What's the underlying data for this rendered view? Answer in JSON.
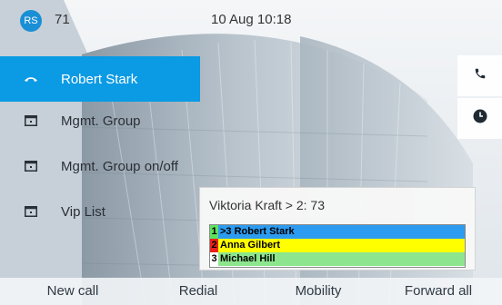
{
  "header": {
    "avatar_initials": "RS",
    "extension": "71",
    "datetime": "10 Aug 10:18"
  },
  "lines": [
    {
      "label": "Robert Stark",
      "icon": "phone-handset-icon",
      "active": true
    },
    {
      "label": "Mgmt. Group",
      "icon": "line-key-icon",
      "active": false
    },
    {
      "label": "Mgmt. Group on/off",
      "icon": "line-key-icon",
      "active": false
    },
    {
      "label": "Vip List",
      "icon": "line-key-icon",
      "active": false
    }
  ],
  "side_buttons": [
    {
      "icon": "phone-icon"
    },
    {
      "icon": "clock-icon"
    }
  ],
  "popup": {
    "title": "Viktoria Kraft > 2: 73",
    "rows": [
      {
        "index": "1",
        "name": ">3 Robert Stark",
        "index_color": "#5fe05f",
        "color": "#2d9bf0"
      },
      {
        "index": "2",
        "name": "Anna Gilbert",
        "index_color": "#e8221b",
        "color": "#ffff00"
      },
      {
        "index": "3",
        "name": "Michael Hill",
        "index_color": "#ffffff",
        "color": "#8de68d"
      }
    ]
  },
  "softkeys": [
    "New call",
    "Redial",
    "Mobility",
    "Forward all"
  ],
  "colors": {
    "accent": "#0b9ae4",
    "avatar": "#1a8fd6"
  }
}
